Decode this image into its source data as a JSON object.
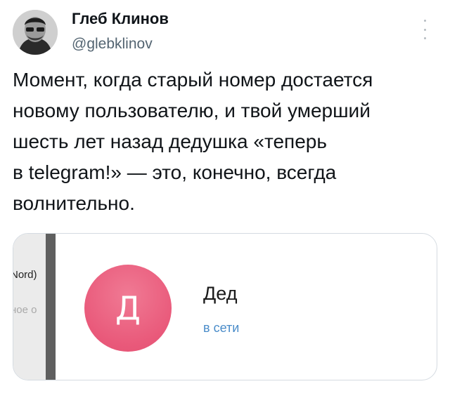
{
  "tweet": {
    "author_name": "Глеб Клинов",
    "author_handle": "@glebklinov",
    "text_lines": [
      "Момент, когда старый номер достается",
      "новому пользователю, и твой умерший",
      "шесть лет назад дедушка «теперь",
      "в telegram!» — это, конечно, всегда",
      "волнительно."
    ]
  },
  "media": {
    "strip_text_top": "Nord)",
    "strip_text_bottom": "ное о",
    "contact": {
      "avatar_letter": "Д",
      "name": "Дед",
      "status": "в сети"
    }
  },
  "colors": {
    "handle": "#536471",
    "avatar_pink": "#e9597a",
    "status_blue": "#4a8cc9"
  }
}
